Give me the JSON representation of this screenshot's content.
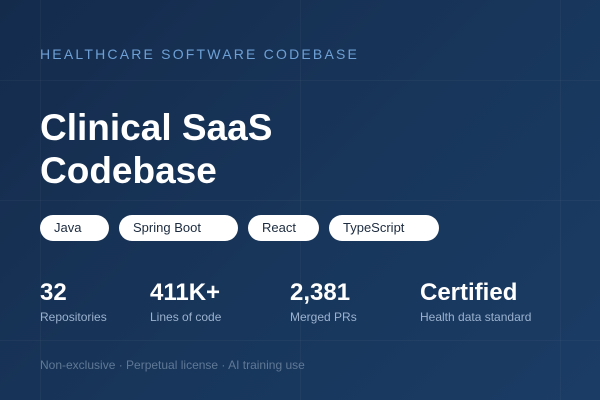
{
  "card": {
    "eyebrow": "HEALTHCARE SOFTWARE CODEBASE",
    "title_line1": "Clinical SaaS",
    "title_line2": "Codebase",
    "tags": [
      "Java",
      "Spring Boot",
      "React",
      "TypeScript"
    ],
    "stats": [
      {
        "value": "32",
        "label": "Repositories"
      },
      {
        "value": "411K+",
        "label": "Lines of code"
      },
      {
        "value": "2,381",
        "label": "Merged PRs"
      },
      {
        "value": "Certified",
        "label": "Health data standard"
      }
    ],
    "footnote": "Non-exclusive · Perpetual license · AI training use"
  },
  "colors": {
    "background_start": "#142b4c",
    "background_end": "#1b3c65",
    "accent": "#6ea0d6",
    "tag_background": "#ffffff",
    "muted_text": "#9bb2cf"
  }
}
